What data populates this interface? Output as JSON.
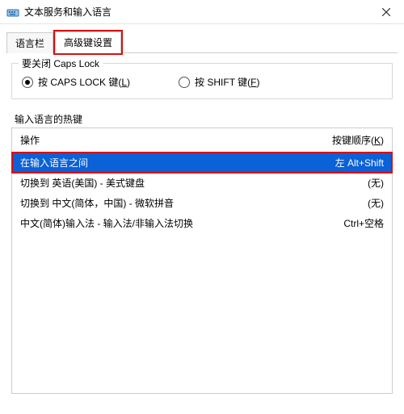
{
  "window": {
    "title": "文本服务和输入语言"
  },
  "tabs": [
    {
      "label": "语言栏",
      "active": false,
      "highlighted": false
    },
    {
      "label": "高级键设置",
      "active": true,
      "highlighted": true
    }
  ],
  "capslock_group": {
    "legend": "要关闭 Caps Lock",
    "options": [
      {
        "label_pre": "按 CAPS LOCK 键(",
        "hotkey": "L",
        "label_post": ")",
        "checked": true
      },
      {
        "label_pre": "按 SHIFT 键(",
        "hotkey": "F",
        "label_post": ")",
        "checked": false
      }
    ]
  },
  "hotkeys": {
    "legend": "输入语言的热键",
    "header_action": "操作",
    "header_keys_pre": "按键顺序(",
    "header_keys_hot": "K",
    "header_keys_post": ")",
    "rows": [
      {
        "action": "在输入语言之间",
        "keys": "左 Alt+Shift",
        "selected": true
      },
      {
        "action": "切换到 英语(美国) - 美式键盘",
        "keys": "(无)",
        "selected": false
      },
      {
        "action": "切换到 中文(简体，中国) - 微软拼音",
        "keys": "(无)",
        "selected": false
      },
      {
        "action": "中文(简体)输入法 - 输入法/非输入法切换",
        "keys": "Ctrl+空格",
        "selected": false
      }
    ]
  }
}
